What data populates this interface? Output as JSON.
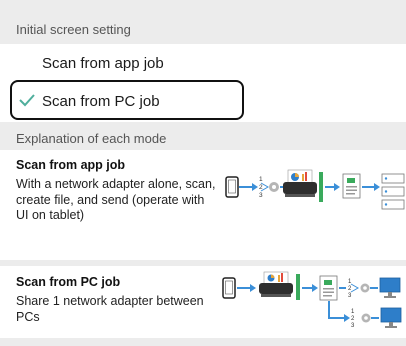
{
  "settings": {
    "header": "Initial screen setting",
    "options": [
      {
        "label": "Scan from app job",
        "selected": false
      },
      {
        "label": "Scan from PC job",
        "selected": true
      }
    ]
  },
  "explanation": {
    "header": "Explanation of each mode",
    "modes": [
      {
        "title": "Scan from app job",
        "description": "With a network adapter alone, scan, create file, and send (operate with UI on tablet)"
      },
      {
        "title": "Scan from PC job",
        "description": "Share 1 network adapter between PCs"
      }
    ]
  },
  "diagram_labels": [
    "1",
    "2",
    "3"
  ],
  "colors": {
    "accent": "#3b8fd8",
    "check": "#4fae9c",
    "scanner_green": "#3aaa5c"
  },
  "icons": [
    "tablet-icon",
    "adapter-icon",
    "scanner-icon",
    "document-icon",
    "list-icon",
    "monitor-icon",
    "check-icon"
  ]
}
